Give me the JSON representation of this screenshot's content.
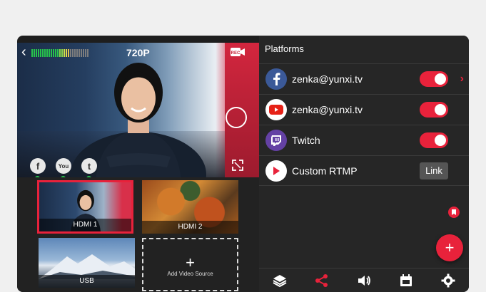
{
  "preview": {
    "resolution": "720P",
    "rec_label": "REC",
    "platforms": [
      {
        "icon": "facebook-icon",
        "glyph": "f",
        "status": "live"
      },
      {
        "icon": "youtube-icon",
        "glyph": "You",
        "status": "live"
      },
      {
        "icon": "twitch-icon",
        "glyph": "t",
        "status": "live"
      }
    ]
  },
  "sources": [
    {
      "label": "HDMI 1",
      "selected": true
    },
    {
      "label": "HDMI 2",
      "selected": false
    },
    {
      "label": "USB",
      "selected": false
    }
  ],
  "add_source_label": "Add Video Source",
  "panel": {
    "title": "Platforms",
    "rows": [
      {
        "icon": "facebook-icon",
        "name": "zenka@yunxi.tv",
        "enabled": true,
        "color": "#3b5998"
      },
      {
        "icon": "youtube-icon",
        "name": "zenka@yunxi.tv",
        "enabled": true,
        "color": "#e62117"
      },
      {
        "icon": "twitch-icon",
        "name": "Twitch",
        "enabled": true,
        "color": "#6441a4"
      },
      {
        "icon": "play-icon",
        "name": "Custom RTMP",
        "action": "Link",
        "color": "#e8223b"
      }
    ]
  },
  "toolbar": [
    "layers-icon",
    "share-icon",
    "volume-icon",
    "calendar-icon",
    "gear-icon"
  ],
  "colors": {
    "accent": "#e8223b",
    "live": "#27c24c"
  }
}
